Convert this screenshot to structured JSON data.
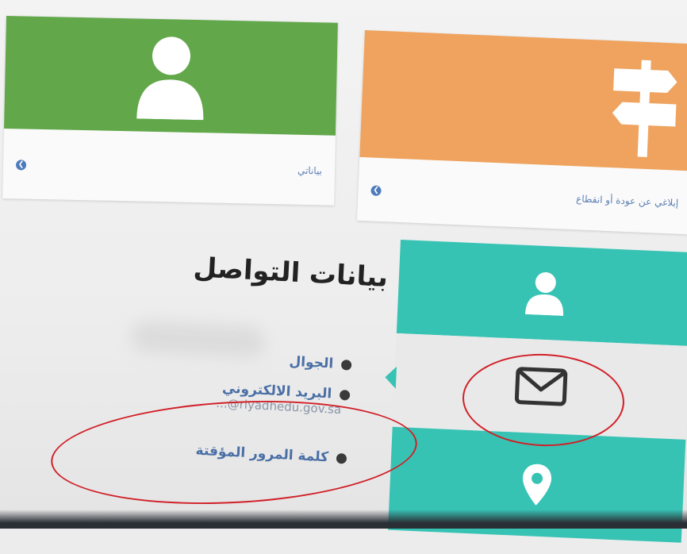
{
  "tiles": {
    "my_data": {
      "label": "بياناتي",
      "color": "#62a84b",
      "icon": "person-icon"
    },
    "report": {
      "label": "إبلاغي عن عودة أو انقطاع",
      "color": "#efa35e",
      "icon": "signpost-icon"
    }
  },
  "contact": {
    "heading": "بيانات التواصل",
    "items": [
      {
        "label": "الجوال"
      },
      {
        "label": "البريد الالكتروني",
        "value": "...@riyadhedu.gov.sa"
      },
      {
        "label": "كلمة المرور المؤقتة"
      }
    ]
  },
  "side_panel": {
    "accent": "#37c3b4",
    "icons": [
      "person-icon",
      "envelope-icon",
      "location-pin-icon"
    ]
  },
  "annotation_color": "#d11f27"
}
